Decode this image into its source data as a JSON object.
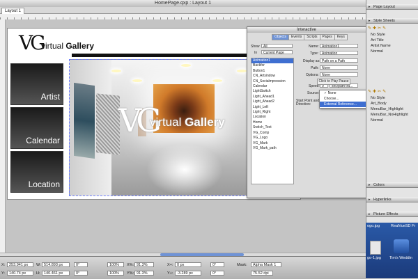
{
  "document": {
    "title": "HomePage.qxp : Layout 1",
    "layout_tab": "Layout 1"
  },
  "page": {
    "logo_mark": "VG",
    "logo_text_light": "virtual ",
    "logo_text_bold": "Gallery",
    "nav": [
      "Artist",
      "Calendar",
      "Location"
    ],
    "overlay_mark": "VG",
    "overlay_text_light": "virtual ",
    "overlay_text_bold": "Gallery"
  },
  "interactive": {
    "title": "Interactive",
    "tabs": [
      "Objects",
      "Events",
      "Scripts",
      "Pages",
      "Keys"
    ],
    "active_tab": "Objects",
    "show_label": "Show",
    "show_value": "All",
    "in_label": "In",
    "in_value": "Current Page",
    "name_label": "Name:",
    "name_value": "Animation1",
    "type_label": "Type:",
    "type_value": "Animation",
    "display_label": "Display as:",
    "display_value": "Path on a Path",
    "path_label": "Path:",
    "path_value": "None",
    "options_label": "Options:",
    "options_value": "None",
    "pause_button": "Click to Play Pause",
    "speed_label": "Speed:",
    "speed_value": "0",
    "speed_unit": "sec/path tra...",
    "source_label": "Source:",
    "start_label": "Start Point and Direction:",
    "objects": [
      "Animation1",
      "Backfor",
      "Button1",
      "CN_Artsindow",
      "CN_Socialmpression",
      "Calendar",
      "LightSwitch",
      "Light_Ahead1",
      "Light_Ahead2",
      "Light_Left",
      "Light_Right",
      "Location",
      "Home",
      "Switch_Text",
      "VG_Comp",
      "VG_Logo",
      "VG_Mark",
      "VG_Mark_path"
    ],
    "selected_object": "Animation1",
    "source_menu": [
      "None",
      "Choose...",
      "External Reference..."
    ],
    "source_menu_checked": "None",
    "source_menu_highlight": "External Reference..."
  },
  "palettes": {
    "page_layout": "Page Layout",
    "style_sheets": "Style Sheets",
    "para_styles": [
      "No Style",
      "Art Title",
      "Artist Name",
      "Normal"
    ],
    "char_styles": [
      "No Style",
      "Art_Body",
      "MenuBar_Highlight",
      "MenuBar_NoHighlight",
      "Normal"
    ],
    "colors": "Colors",
    "hyperlinks": "Hyperlinks",
    "picture_effects": "Picture Effects"
  },
  "desktop": {
    "files": [
      "ogo.jpg",
      "RealVueSD Fr",
      "go-1.jpg",
      "Tim's Weddin"
    ]
  },
  "measurements": {
    "x_label": "X:",
    "x_value": "253.941 px",
    "y_label": "Y:",
    "y_value": "140.74 px",
    "w_label": "W:",
    "w_value": "514.893 px",
    "h_label": "H:",
    "h_value": "140.461 px",
    "angle1": "0°",
    "angle2": "0°",
    "pct1": "100%",
    "pct2": "100%",
    "xpct_label": "X%:",
    "xpct_value": "91.3%",
    "ypct_label": "Y%:",
    "ypct_value": "91.3%",
    "xplus_label": "X+:",
    "xplus_value": "0 px",
    "yplus_label": "Y+:",
    "yplus_value": "-3.289 px",
    "angle3": "0°",
    "angle4": "0°",
    "mask_label": "Mask:",
    "mask_value": "Alpha Mask 1",
    "effective_value": "75.52 dpi"
  }
}
